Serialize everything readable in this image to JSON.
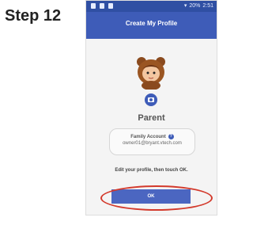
{
  "step": {
    "label": "Step 12"
  },
  "status_bar": {
    "battery": "20%",
    "time": "2:51"
  },
  "header": {
    "title": "Create My Profile"
  },
  "profile": {
    "name": "Parent",
    "account_label": "Family Account",
    "email": "owner01@bryant.vtech.com"
  },
  "instruction": "Edit your profile, then touch OK.",
  "ok_button": {
    "label": "OK"
  },
  "colors": {
    "header_blue": "#3e5cb8",
    "status_blue": "#2f4fa3",
    "highlight_red": "#d33a2c"
  },
  "icons": [
    "camera-icon",
    "pencil-icon",
    "help-icon",
    "bear-avatar-icon"
  ]
}
